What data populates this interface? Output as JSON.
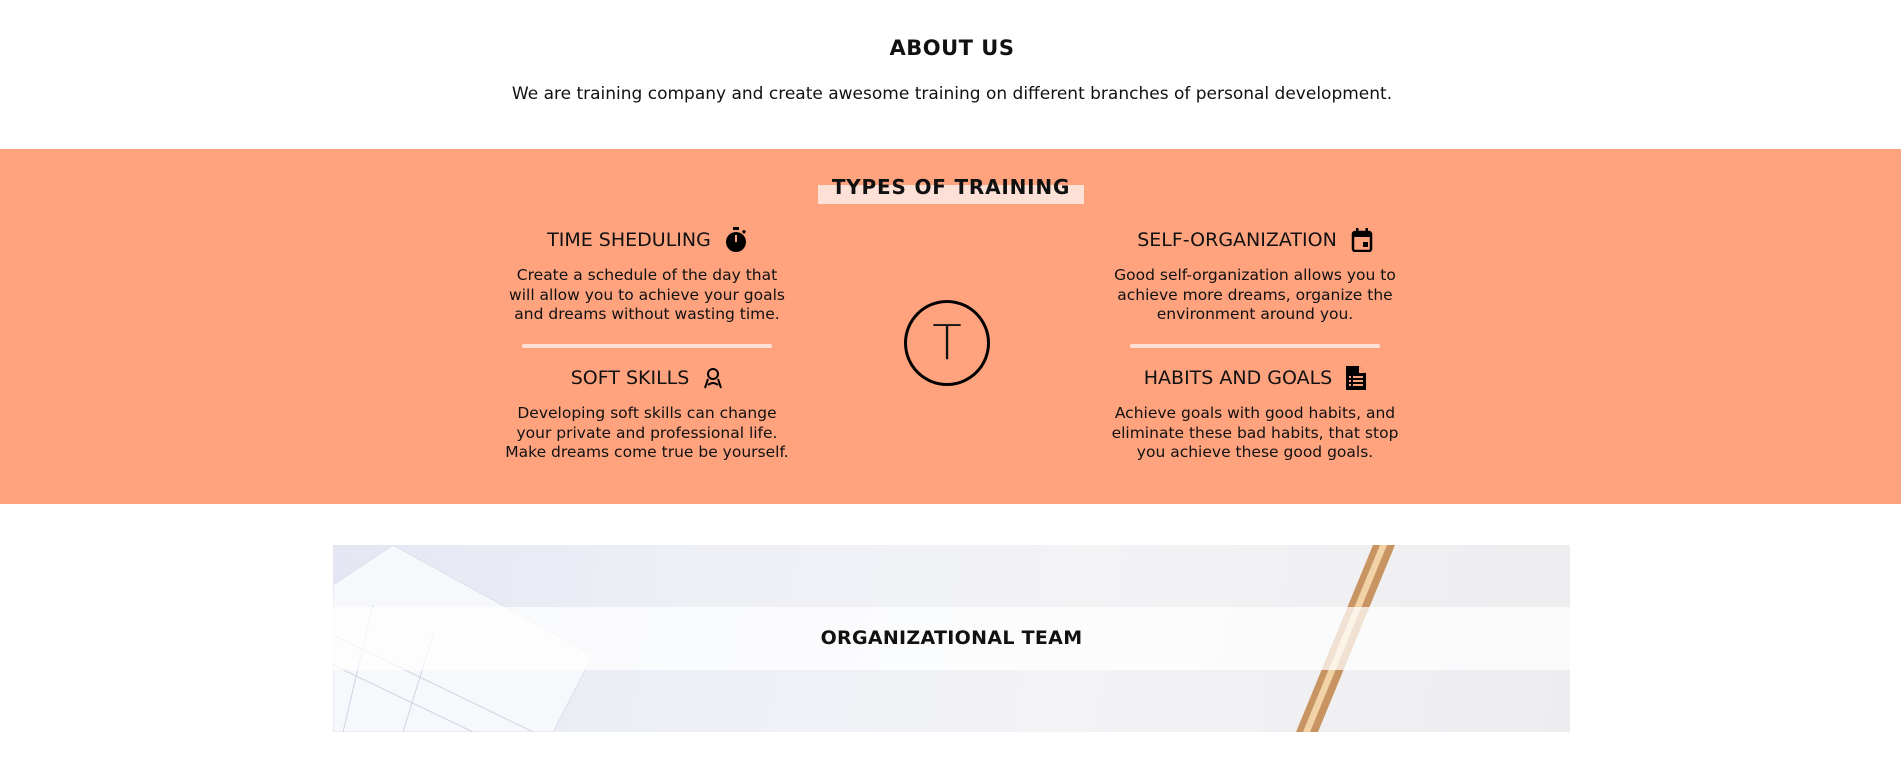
{
  "about": {
    "title": "ABOUT US",
    "text": "We are training company and create awesome training on different branches of personal development."
  },
  "training": {
    "title": "TYPES OF TRAINING",
    "logo_letter": "T",
    "accent_color": "#FFA37F",
    "highlight_color": "#FDE0D6",
    "items": [
      {
        "title": "TIME SHEDULING",
        "icon": "stopwatch-icon",
        "lines": [
          "Create a schedule of the day that",
          "will allow you to achieve your goals",
          "and dreams without wasting time."
        ]
      },
      {
        "title": "SOFT SKILLS",
        "icon": "user-icon",
        "lines": [
          "Developing soft skills can change",
          "your private and professional life.",
          "Make dreams come true be yourself."
        ]
      },
      {
        "title": "SELF-ORGANIZATION",
        "icon": "calendar-icon",
        "lines": [
          "Good self-organization allows you to",
          "achieve more dreams, organize the",
          "environment around you."
        ]
      },
      {
        "title": "HABITS AND GOALS",
        "icon": "document-list-icon",
        "lines": [
          "Achieve goals with good habits, and",
          "eliminate these bad habits, that stop",
          "you achieve these good goals."
        ]
      }
    ]
  },
  "team": {
    "title": "ORGANIZATIONAL TEAM"
  }
}
